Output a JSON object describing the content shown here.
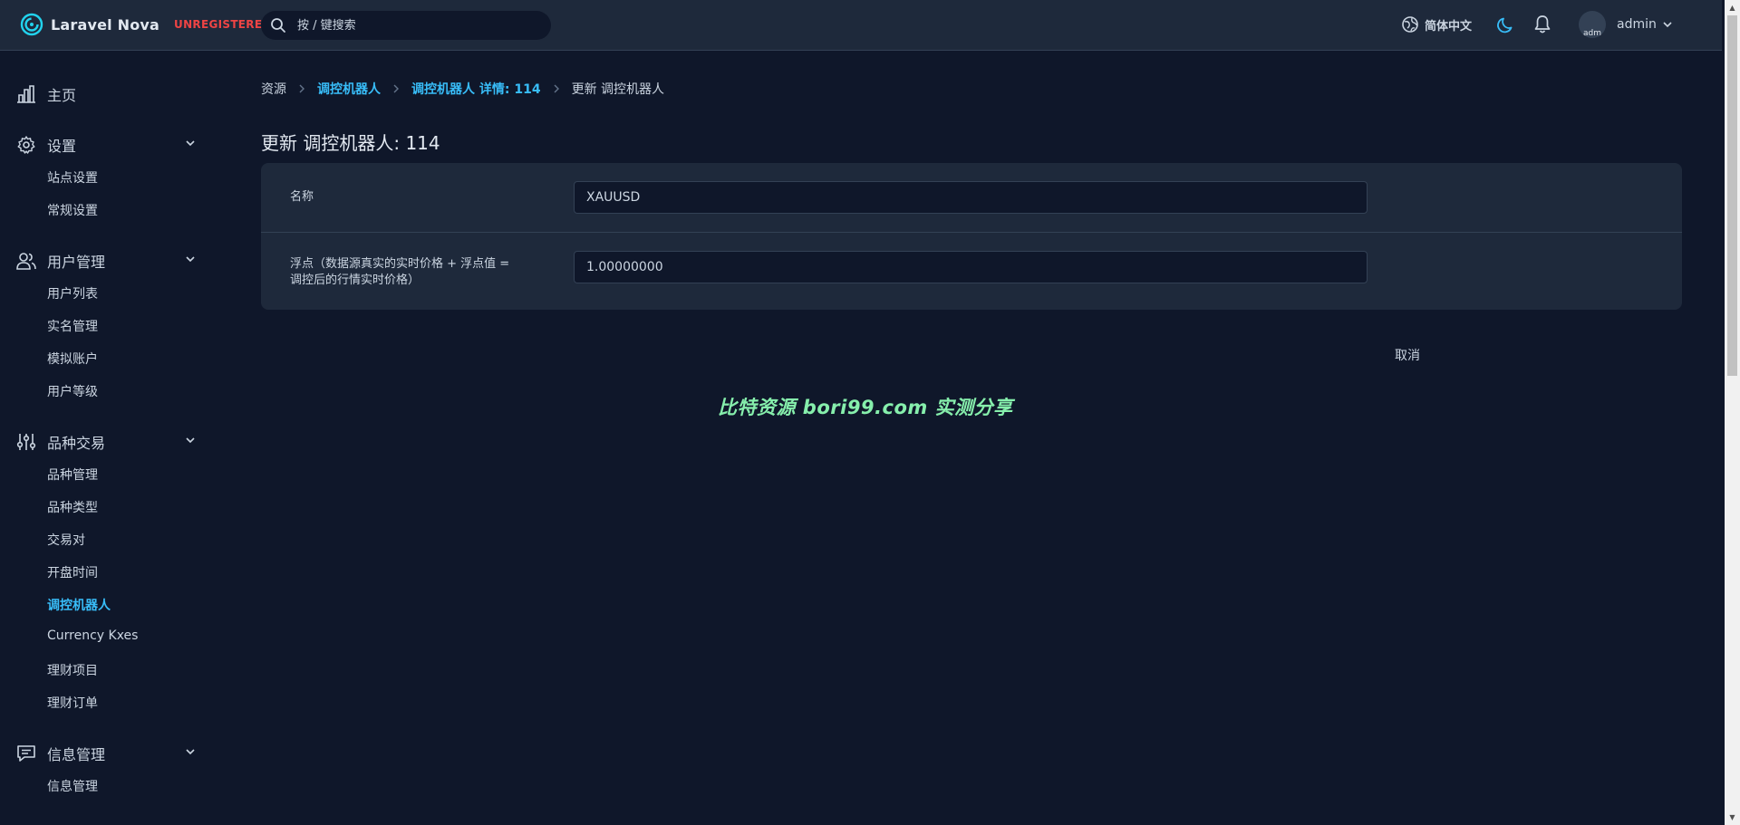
{
  "brand": {
    "name": "Laravel Nova",
    "badge": "UNREGISTERED"
  },
  "search": {
    "placeholder": "按 / 键搜索"
  },
  "header": {
    "language": "简体中文",
    "user_name": "admin",
    "avatar_alt": "adm"
  },
  "sidebar": {
    "home": "主页",
    "groups": [
      {
        "label": "设置",
        "items": [
          "站点设置",
          "常规设置"
        ]
      },
      {
        "label": "用户管理",
        "items": [
          "用户列表",
          "实名管理",
          "模拟账户",
          "用户等级"
        ]
      },
      {
        "label": "品种交易",
        "items": [
          "品种管理",
          "品种类型",
          "交易对",
          "开盘时间",
          "调控机器人",
          "Currency Kxes",
          "理财项目",
          "理财订单"
        ]
      },
      {
        "label": "信息管理",
        "items": [
          "信息管理"
        ]
      }
    ],
    "active_item": "调控机器人"
  },
  "breadcrumb": [
    "资源",
    "调控机器人",
    "调控机器人 详情: 114",
    "更新 调控机器人"
  ],
  "page": {
    "title": "更新 调控机器人: 114"
  },
  "form": {
    "fields": [
      {
        "label": "名称",
        "value": "XAUUSD"
      },
      {
        "label": "浮点（数据源真实的实时价格 + 浮点值 = 调控后的行情实时价格）",
        "value": "1.00000000"
      }
    ],
    "cancel_label": "取消"
  },
  "watermark": "比特资源 bori99.com 实测分享",
  "colors": {
    "accent": "#38bdf8",
    "badge": "#ef4444",
    "watermark": "#86efac",
    "background": "#0f172a",
    "surface": "#1e293b"
  }
}
